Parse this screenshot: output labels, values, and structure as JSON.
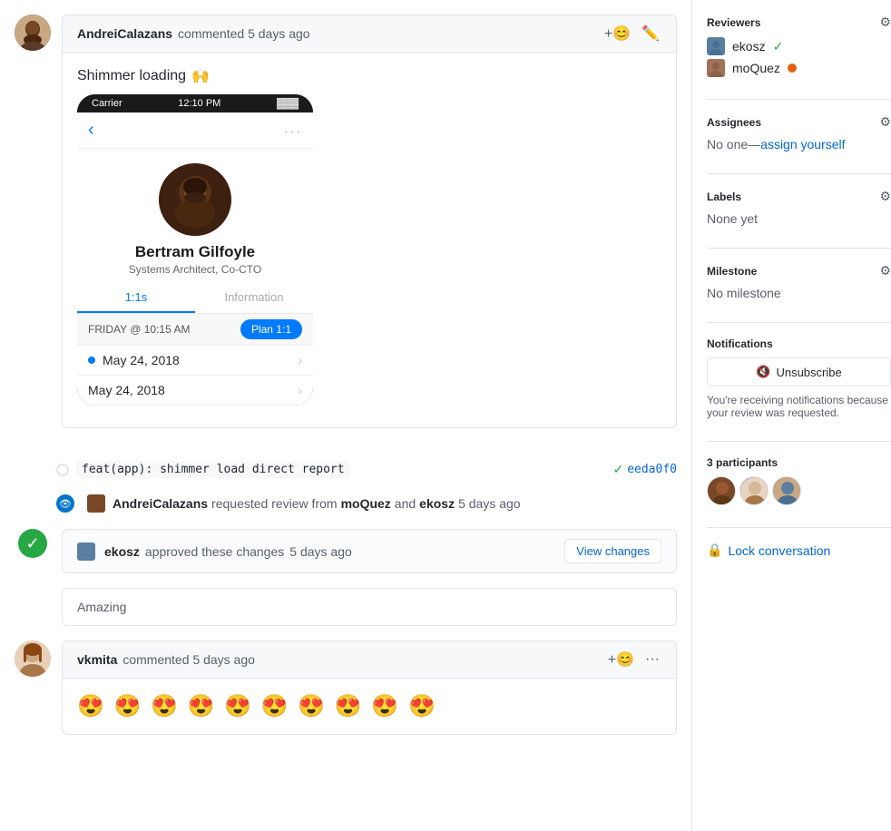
{
  "page": {
    "main": {
      "comment1": {
        "author": "AndreiCalazans",
        "time": "commented 5 days ago",
        "shimmer_text": "Shimmer loading",
        "shimmer_emoji": "🙌",
        "phone": {
          "carrier": "Carrier",
          "time": "12:10 PM",
          "battery": "▓▓▓",
          "name": "Bertram Gilfoyle",
          "title": "Systems Architect, Co-CTO",
          "tab1": "1:1s",
          "tab2": "Information",
          "meeting_time": "FRIDAY @ 10:15 AM",
          "meeting_btn": "Plan 1:1",
          "date1": "May 24, 2018",
          "date2": "May 24, 2018"
        }
      },
      "commit": {
        "code": "feat(app): shimmer load direct report",
        "hash": "eeda0f0",
        "check": "✓"
      },
      "requested_review": {
        "author": "AndreiCalazans",
        "action": "requested review from",
        "reviewer1": "moQuez",
        "connector": "and",
        "reviewer2": "ekosz",
        "time": "5 days ago"
      },
      "approval": {
        "author": "ekosz",
        "text": "approved these changes",
        "time": "5 days ago",
        "btn_label": "View changes"
      },
      "approval_comment": {
        "text": "Amazing"
      },
      "comment2": {
        "author": "vkmita",
        "time": "commented 5 days ago",
        "emojis": "😍 😍 😍 😍 😍 😍 😍 😍 😍 😍"
      }
    },
    "sidebar": {
      "reviewers_label": "Reviewers",
      "reviewers": [
        {
          "name": "ekosz",
          "status": "approved"
        },
        {
          "name": "moQuez",
          "status": "pending"
        }
      ],
      "assignees_label": "Assignees",
      "assignees_none": "No one—assign yourself",
      "labels_label": "Labels",
      "labels_none": "None yet",
      "milestone_label": "Milestone",
      "milestone_none": "No milestone",
      "notifications_label": "Notifications",
      "unsubscribe_btn": "Unsubscribe",
      "notification_text": "You're receiving notifications because your review was requested.",
      "participants_label": "3 participants",
      "lock_label": "Lock conversation"
    }
  }
}
